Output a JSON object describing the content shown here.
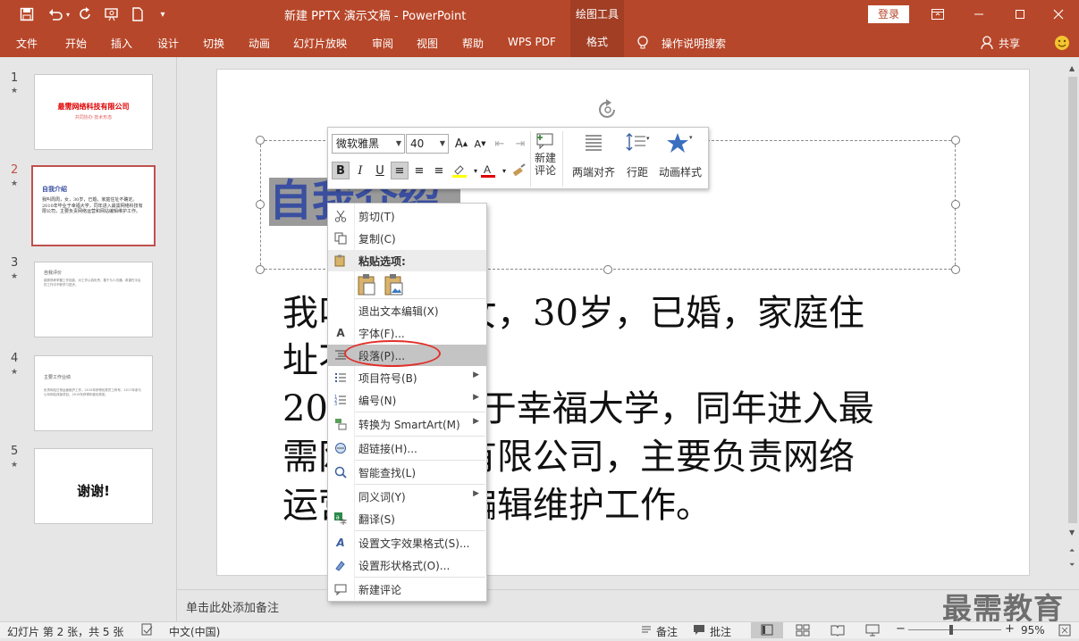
{
  "app": {
    "title": "新建 PPTX 演示文稿 - PowerPoint",
    "context_tab_title": "绘图工具",
    "login_label": "登录",
    "share_label": "共享",
    "tell_me": "操作说明搜索"
  },
  "ribbon_tabs": [
    "文件",
    "开始",
    "插入",
    "设计",
    "切换",
    "动画",
    "幻灯片放映",
    "审阅",
    "视图",
    "帮助",
    "WPS PDF",
    "格式"
  ],
  "thumbnails": [
    {
      "num": "1",
      "title": "最需网络科技有限公司",
      "subtitle": "共同协办 技术形态"
    },
    {
      "num": "2",
      "title": "自我介绍",
      "body": "我叫周周，女，30岁，已婚，家庭住址不确定。2010年毕业于幸福大学，同年进入最需网络科技有限公司，主要负责网络运营和网站编辑维护工作。"
    },
    {
      "num": "3",
      "title": "自我评价",
      "body": "能够熟练掌握工作技能，对工作认真负责，善于与人沟通。希望在今后的工作中不断学习进步。"
    },
    {
      "num": "4",
      "title": "主要工作业绩",
      "body": "负责网站日常运营维护工作。2015年获得优秀员工称号。2017年参与公司网站改版项目。2019年获得年度优秀奖。"
    },
    {
      "num": "5",
      "title": "谢谢!"
    }
  ],
  "slide": {
    "title_text": "自我介绍",
    "body_lines": [
      "我叫周周，女，30岁，已婚，家庭住",
      "址不确定。",
      "2010年毕业于幸福大学，同年进入最",
      "需网络科技有限公司，主要负责网络",
      "运营和网站编辑维护工作。"
    ]
  },
  "mini_toolbar": {
    "font_name": "微软雅黑",
    "font_size": "40",
    "new_comment_label": "新建\n评论",
    "justify_label": "两端对齐",
    "line_spacing_label": "行距",
    "animation_label": "动画样式"
  },
  "context_menu": [
    {
      "label": "剪切(T)",
      "icon": "scissors-icon",
      "glyph": "✂"
    },
    {
      "label": "复制(C)",
      "icon": "copy-icon",
      "glyph": "⧉"
    },
    {
      "label": "粘贴选项:",
      "icon": "paste-icon",
      "glyph": "📋"
    },
    {
      "label": "退出文本编辑(X)",
      "icon": "",
      "glyph": ""
    },
    {
      "label": "字体(F)...",
      "icon": "font-icon",
      "glyph": "A"
    },
    {
      "label": "段落(P)...",
      "icon": "paragraph-icon",
      "glyph": "≡"
    },
    {
      "label": "项目符号(B)",
      "icon": "bullets-icon",
      "glyph": "☰"
    },
    {
      "label": "编号(N)",
      "icon": "numbering-icon",
      "glyph": "☷"
    },
    {
      "label": "转换为 SmartArt(M)",
      "icon": "smartart-icon",
      "glyph": "▦"
    },
    {
      "label": "超链接(H)...",
      "icon": "hyperlink-icon",
      "glyph": "🔗"
    },
    {
      "label": "智能查找(L)",
      "icon": "smart-lookup-icon",
      "glyph": "🔍"
    },
    {
      "label": "同义词(Y)",
      "icon": "",
      "glyph": ""
    },
    {
      "label": "翻译(S)",
      "icon": "translate-icon",
      "glyph": "文"
    },
    {
      "label": "设置文字效果格式(S)...",
      "icon": "text-effects-icon",
      "glyph": "A"
    },
    {
      "label": "设置形状格式(O)...",
      "icon": "shape-format-icon",
      "glyph": "◈"
    },
    {
      "label": "新建评论",
      "icon": "new-comment-icon",
      "glyph": "💬"
    }
  ],
  "notes_placeholder": "单击此处添加备注",
  "status": {
    "slide_info": "幻灯片 第 2 张，共 5 张",
    "language": "中文(中国)",
    "notes_btn": "备注",
    "comments_btn": "批注",
    "zoom": "95%"
  },
  "watermark": "最需教育",
  "colors": {
    "accent": "#b7472a",
    "selected_thumb": "#c0504d",
    "highlight_ellipse": "#e0302a"
  }
}
